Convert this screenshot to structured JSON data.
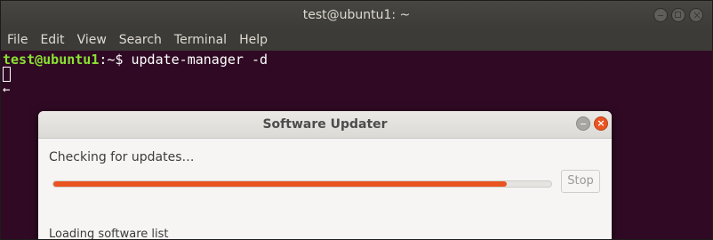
{
  "terminal": {
    "title": "test@ubuntu1: ~",
    "menu": [
      "File",
      "Edit",
      "View",
      "Search",
      "Terminal",
      "Help"
    ],
    "prompt_user": "test@ubuntu1",
    "prompt_sep": ":~$ ",
    "command": "update-manager -d"
  },
  "dialog": {
    "title": "Software Updater",
    "status": "Checking for updates…",
    "progress_fraction": 0.91,
    "stop_label": "Stop",
    "sub_status": "Loading software list"
  },
  "colors": {
    "terminal_bg": "#300a24",
    "accent": "#e95420",
    "prompt_user": "#8ae234",
    "prompt_path": "#729fcf"
  }
}
